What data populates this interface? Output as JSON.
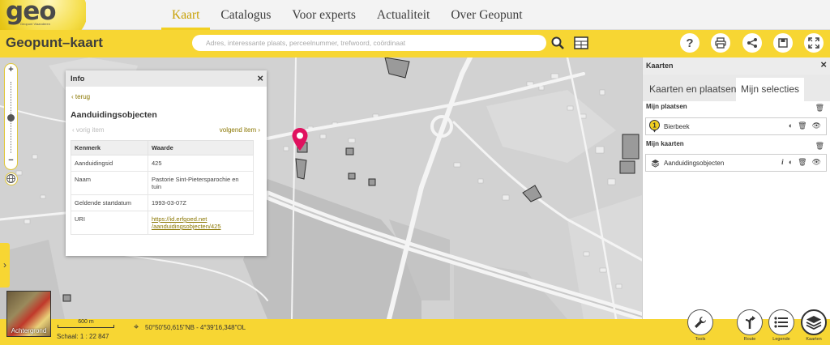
{
  "logo": {
    "text": "geo",
    "subtitle": "Geopunt Vlaanderen"
  },
  "nav": {
    "items": [
      "Kaart",
      "Catalogus",
      "Voor experts",
      "Actualiteit",
      "Over Geopunt"
    ],
    "active": "Kaart"
  },
  "toolbar": {
    "app_title": "Geopunt–kaart",
    "search_placeholder": "Adres, interessante plaats, perceelnummer, trefwoord, coördinaat",
    "buttons": [
      "search-icon",
      "layers-grid-icon",
      "help-icon",
      "print-icon",
      "share-icon",
      "bookmark-icon",
      "fullscreen-icon"
    ]
  },
  "zoom": {
    "plus": "+",
    "minus": "−"
  },
  "info": {
    "title": "Info",
    "close": "×",
    "back": "terug",
    "name": "Aanduidingsobjecten",
    "prev": "vorig item",
    "next": "volgend item",
    "table": {
      "headers": [
        "Kenmerk",
        "Waarde"
      ],
      "rows": [
        [
          "Aanduidingsid",
          "425"
        ],
        [
          "Naam",
          "Pastorie Sint-Pietersparochie en tuin"
        ],
        [
          "Geldende startdatum",
          "1993-03-07Z"
        ],
        [
          "URI",
          "https://id.erfgoed.net /aanduidingsobjecten/425"
        ]
      ]
    }
  },
  "panel": {
    "title": "Kaarten",
    "close": "×",
    "tabs": [
      "Kaarten en plaatsen",
      "Mijn selecties"
    ],
    "active_tab": "Mijn selecties",
    "places_title": "Mijn plaatsen",
    "place": "Bierbeek",
    "maps_title": "Mijn kaarten",
    "map_layer": "Aanduidingsobjecten"
  },
  "bottom": {
    "basemap_label": "Achtergrond",
    "scale_distance": "600 m",
    "scale_text": "Schaal: 1 : 22 847",
    "coordinates": "50°50'50,615\"NB - 4°39'16,348\"OL",
    "buttons": [
      {
        "name": "tools",
        "label": "Tools"
      },
      {
        "name": "route",
        "label": "Route"
      },
      {
        "name": "legend",
        "label": "Legende"
      },
      {
        "name": "maps",
        "label": "Kaarten"
      }
    ]
  },
  "colors": {
    "brand_yellow": "#f7d633",
    "accent_gold": "#c79f00",
    "marker": "#e0115f"
  }
}
